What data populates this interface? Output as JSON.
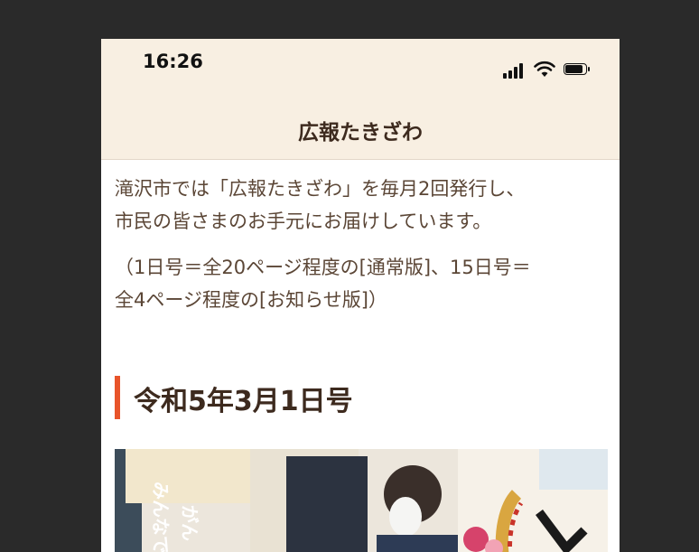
{
  "status_bar": {
    "time": "16:26",
    "icons": [
      "signal-icon",
      "wifi-icon",
      "battery-icon"
    ]
  },
  "header": {
    "title": "広報たきざわ",
    "background": "#f8efe2"
  },
  "intro": {
    "line1": "滝沢市では「広報たきざわ」を毎月2回発行し、",
    "line2": "市民の皆さまのお手元にお届けしています。",
    "note_line1": "（1日号＝全20ページ程度の[通常版]、15日号＝",
    "note_line2": "全4ページ程度の[お知らせ版]）"
  },
  "issue": {
    "title": "令和5年3月1日号",
    "accent_color": "#e8542a",
    "cover_image": "issue-cover-image"
  }
}
